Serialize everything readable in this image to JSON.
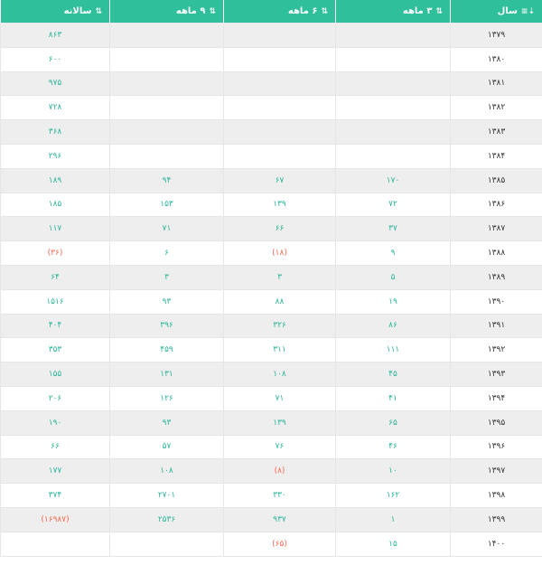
{
  "table": {
    "headers": [
      "سال",
      "۳ ماهه",
      "۶ ماهه",
      "۹ ماهه",
      "سالانه"
    ],
    "rows": [
      [
        "۱۳۷۹",
        "",
        "",
        "",
        "۸۶۳"
      ],
      [
        "۱۳۸۰",
        "",
        "",
        "",
        "۶۰۰"
      ],
      [
        "۱۳۸۱",
        "",
        "",
        "",
        "۹۷۵"
      ],
      [
        "۱۳۸۲",
        "",
        "",
        "",
        "۷۲۸"
      ],
      [
        "۱۳۸۳",
        "",
        "",
        "",
        "۳۶۸"
      ],
      [
        "۱۳۸۴",
        "",
        "",
        "",
        "۲۹۶"
      ],
      [
        "۱۳۸۵",
        "۱۷۰",
        "۶۷",
        "۹۴",
        "۱۸۹"
      ],
      [
        "۱۳۸۶",
        "۷۲",
        "۱۳۹",
        "۱۵۳",
        "۱۸۵"
      ],
      [
        "۱۳۸۷",
        "۳۷",
        "۶۶",
        "۷۱",
        "۱۱۷"
      ],
      [
        "۱۳۸۸",
        "۹",
        "(۱۸)",
        "۶",
        "(۳۶)"
      ],
      [
        "۱۳۸۹",
        "۵",
        "۳",
        "۳",
        "۶۴"
      ],
      [
        "۱۳۹۰",
        "۱۹",
        "۸۸",
        "۹۳",
        "۱۵۱۶"
      ],
      [
        "۱۳۹۱",
        "۸۶",
        "۳۲۶",
        "۳۹۶",
        "۴۰۴"
      ],
      [
        "۱۳۹۲",
        "۱۱۱",
        "۳۱۱",
        "۴۵۹",
        "۳۵۳"
      ],
      [
        "۱۳۹۳",
        "۴۵",
        "۱۰۸",
        "۱۳۱",
        "۱۵۵"
      ],
      [
        "۱۳۹۴",
        "۴۱",
        "۷۱",
        "۱۲۶",
        "۲۰۶"
      ],
      [
        "۱۳۹۵",
        "۶۵",
        "۱۳۹",
        "۹۳",
        "۱۹۰"
      ],
      [
        "۱۳۹۶",
        "۴۶",
        "۷۶",
        "۵۷",
        "۶۶"
      ],
      [
        "۱۳۹۷",
        "۱۰",
        "(۸)",
        "۱۰۸",
        "۱۷۷"
      ],
      [
        "۱۳۹۸",
        "۱۶۲",
        "۳۳۰",
        "۲۷۰۱",
        "۳۷۴"
      ],
      [
        "۱۳۹۹",
        "۱",
        "۹۳۷",
        "۲۵۳۶",
        "(۱۶۹۸۷)"
      ],
      [
        "۱۴۰۰",
        "۱۵",
        "(۶۵)",
        "",
        ""
      ]
    ]
  },
  "icons": {
    "sort_year": "sort-ascending-icon",
    "sort_other": "sort-both-icon"
  },
  "colors": {
    "header_bg": "#2fbf9a",
    "number": "#2bb59a",
    "negative": "#ff6a50",
    "row_stripe": "#eeeeee"
  }
}
